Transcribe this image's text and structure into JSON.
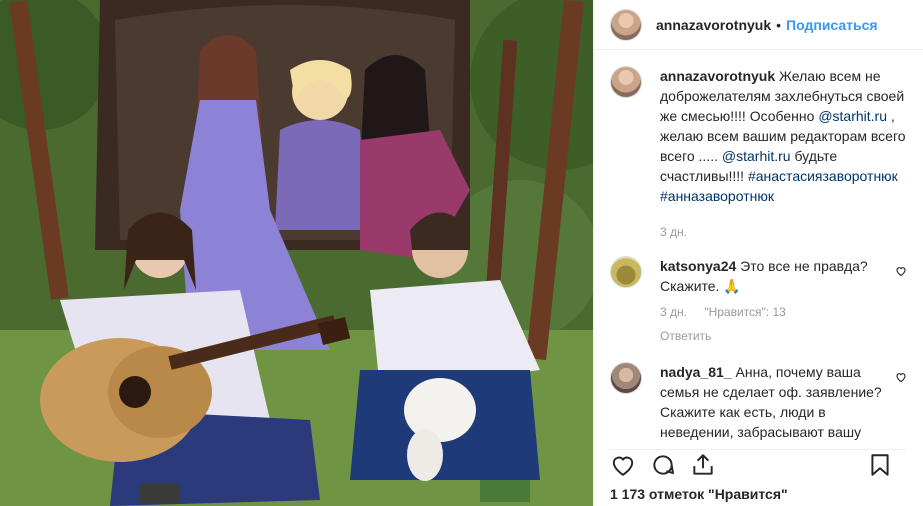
{
  "post": {
    "image_alt": "Family photo on garden swing",
    "author": {
      "username": "annazavorotnyuk",
      "separator": "•",
      "follow_label": "Подписаться"
    }
  },
  "caption": {
    "username": "annazavorotnyuk",
    "text_1": "Желаю всем не доброжелателям захлебнуться своей же смесью!!!! Особенно ",
    "mention_1": "@starhit.ru",
    "text_2": " , желаю всем вашим редакторам всего всего ..... ",
    "mention_2": "@starhit.ru",
    "text_3": " будьте счастливы!!!! ",
    "hashtag_1": "#анастасиязаворотнюк",
    "hashtag_2": "#анназаворотнюк",
    "time": "3 дн."
  },
  "comments": [
    {
      "username": "katsonya24",
      "text": "Это все не правда? Скажите. 🙏",
      "time": "3 дн.",
      "likes": "\"Нравится\": 13",
      "reply": "Ответить"
    },
    {
      "username": "nadya_81_",
      "text": "Анна, почему ваша семья не сделает оф. заявление? Скажите как есть, люди в неведении, забрасывают вашу"
    }
  ],
  "footer": {
    "likes_text": "1 173 отметок \"Нравится\""
  },
  "icons": {
    "like": "heart-icon",
    "comment": "comment-icon",
    "share": "share-icon",
    "save": "bookmark-icon",
    "comment_like": "small-heart-icon"
  }
}
